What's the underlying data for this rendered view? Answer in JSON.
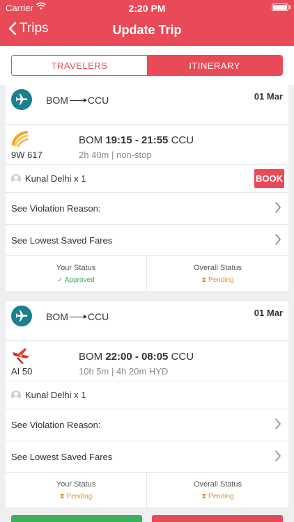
{
  "status_bar": {
    "carrier": "Carrier",
    "time": "2:20 PM"
  },
  "nav": {
    "back_label": "Trips",
    "title": "Update Trip"
  },
  "tabs": [
    {
      "label": "TRAVELERS",
      "active": false
    },
    {
      "label": "ITINERARY",
      "active": true
    }
  ],
  "colors": {
    "brand": "#e94a57",
    "plane_icon_bg": "#1a7f8e",
    "approved": "#3ea55c",
    "pending": "#e0962c",
    "confirm_button": "#3bb05d"
  },
  "trips": [
    {
      "route_from": "BOM",
      "route_to": "CCU",
      "date": "01 Mar",
      "airline_icon": "indigo-logo-icon",
      "flight_no": "9W 617",
      "origin": "BOM",
      "times": "19:15 - 21:55",
      "destination": "CCU",
      "duration": "2h 40m | non-stop",
      "traveler": "Kunal Delhi x 1",
      "book_label": "BOOK",
      "violation_label": "See Violation Reason:",
      "fares_label": "See Lowest Saved Fares",
      "your_status_label": "Your Status",
      "your_status_value": "✓ Approved",
      "overall_status_label": "Overall Status",
      "overall_status_value": "⧗ Pending"
    },
    {
      "route_from": "BOM",
      "route_to": "CCU",
      "date": "01 Mar",
      "airline_icon": "air-india-logo-icon",
      "flight_no": "AI 50",
      "origin": "BOM",
      "times": "22:00 - 08:05",
      "destination": "CCU",
      "duration": "10h 5m | 4h 20m HYD",
      "traveler": "Kunal Delhi x 1",
      "violation_label": "See Violation Reason:",
      "fares_label": "See Lowest Saved Fares",
      "your_status_label": "Your Status",
      "your_status_value": "⧗ Pending",
      "overall_status_label": "Overall Status",
      "overall_status_value": "⧗ Pending"
    }
  ]
}
